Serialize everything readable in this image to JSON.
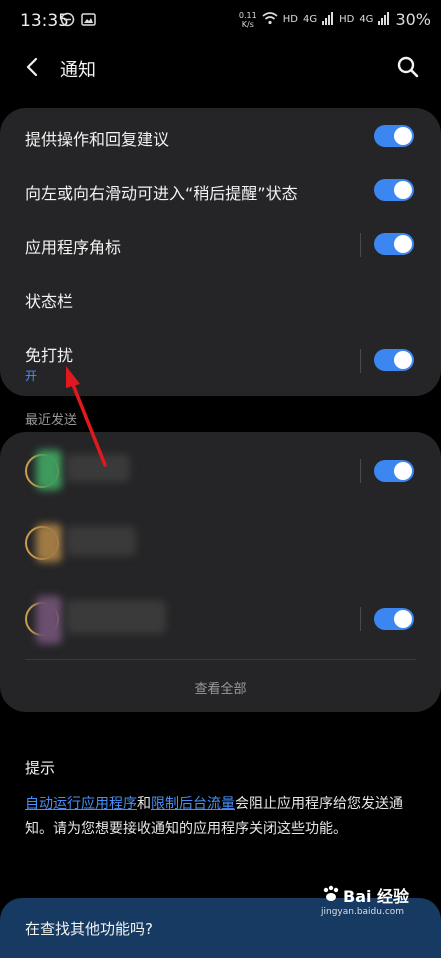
{
  "status_bar": {
    "time": "13:35",
    "speed_value": "0.11",
    "speed_unit": "K/s",
    "hd1": "HD",
    "net1": "4G",
    "hd2": "HD",
    "net2": "4G",
    "battery": "30%"
  },
  "header": {
    "title": "通知"
  },
  "settings": {
    "items": [
      {
        "label": "提供操作和回复建议"
      },
      {
        "label": "向左或向右滑动可进入“稍后提醒”状态"
      },
      {
        "label": "应用程序角标"
      },
      {
        "label": "状态栏"
      },
      {
        "label": "免打扰",
        "sub": "开"
      }
    ]
  },
  "recent": {
    "section_label": "最近发送",
    "see_all": "查看全部"
  },
  "tips": {
    "title": "提示",
    "link1": "自动运行应用程序",
    "conj": "和",
    "link2": "限制后台流量",
    "text_after": "会阻止应用程序给您发送通知。请为您想要接收通知的应用程序关闭这些功能。"
  },
  "bottom": {
    "text": "在查找其他功能吗?"
  },
  "watermark": {
    "main": "Bai 经验",
    "sub": "jingyan.baidu.com"
  },
  "colors": {
    "accent": "#3b86f0",
    "card": "#252527",
    "annotation_arrow": "#e0191e"
  }
}
